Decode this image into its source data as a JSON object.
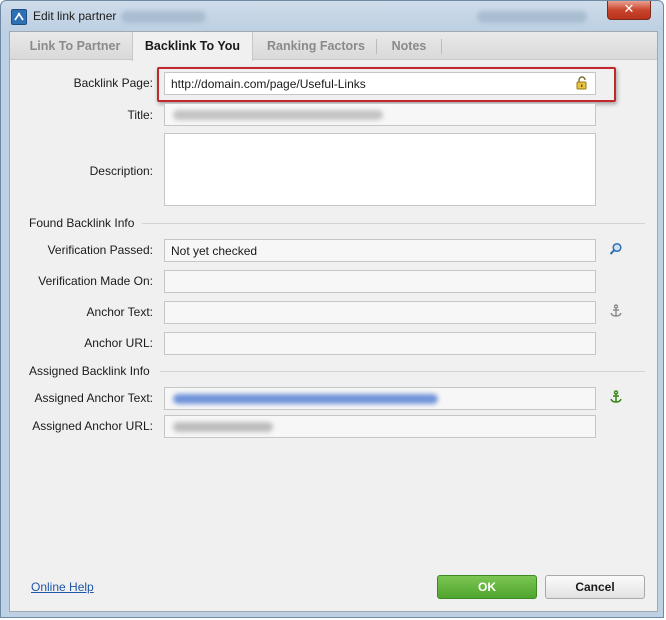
{
  "window": {
    "title": "Edit link partner",
    "close_glyph": "✕"
  },
  "tabs": [
    {
      "label": "Link To Partner",
      "active": false
    },
    {
      "label": "Backlink To You",
      "active": true
    },
    {
      "label": "Ranking Factors",
      "active": false
    },
    {
      "label": "Notes",
      "active": false
    }
  ],
  "form": {
    "backlink_page_label": "Backlink Page:",
    "backlink_page_value": "http://domain.com/page/Useful-Links",
    "title_label": "Title:",
    "description_label": "Description:",
    "description_value": ""
  },
  "found_info": {
    "section_title": "Found Backlink Info",
    "verification_passed_label": "Verification Passed:",
    "verification_passed_value": "Not yet checked",
    "verification_made_label": "Verification Made On:",
    "verification_made_value": "",
    "anchor_text_label": "Anchor Text:",
    "anchor_text_value": "",
    "anchor_url_label": "Anchor URL:",
    "anchor_url_value": ""
  },
  "assigned_info": {
    "section_title": "Assigned Backlink Info",
    "assigned_anchor_text_label": "Assigned Anchor Text:",
    "assigned_anchor_url_label": "Assigned Anchor URL:"
  },
  "footer": {
    "online_help": "Online Help",
    "ok_label": "OK",
    "cancel_label": "Cancel"
  },
  "icons": {
    "lock": "lock-icon",
    "search": "search-icon",
    "anchor": "anchor-icon",
    "assigned_anchor": "anchor-green-icon"
  },
  "colors": {
    "highlight": "#c0282d",
    "ok_button": "#4fa52d",
    "link": "#1f56a8"
  }
}
